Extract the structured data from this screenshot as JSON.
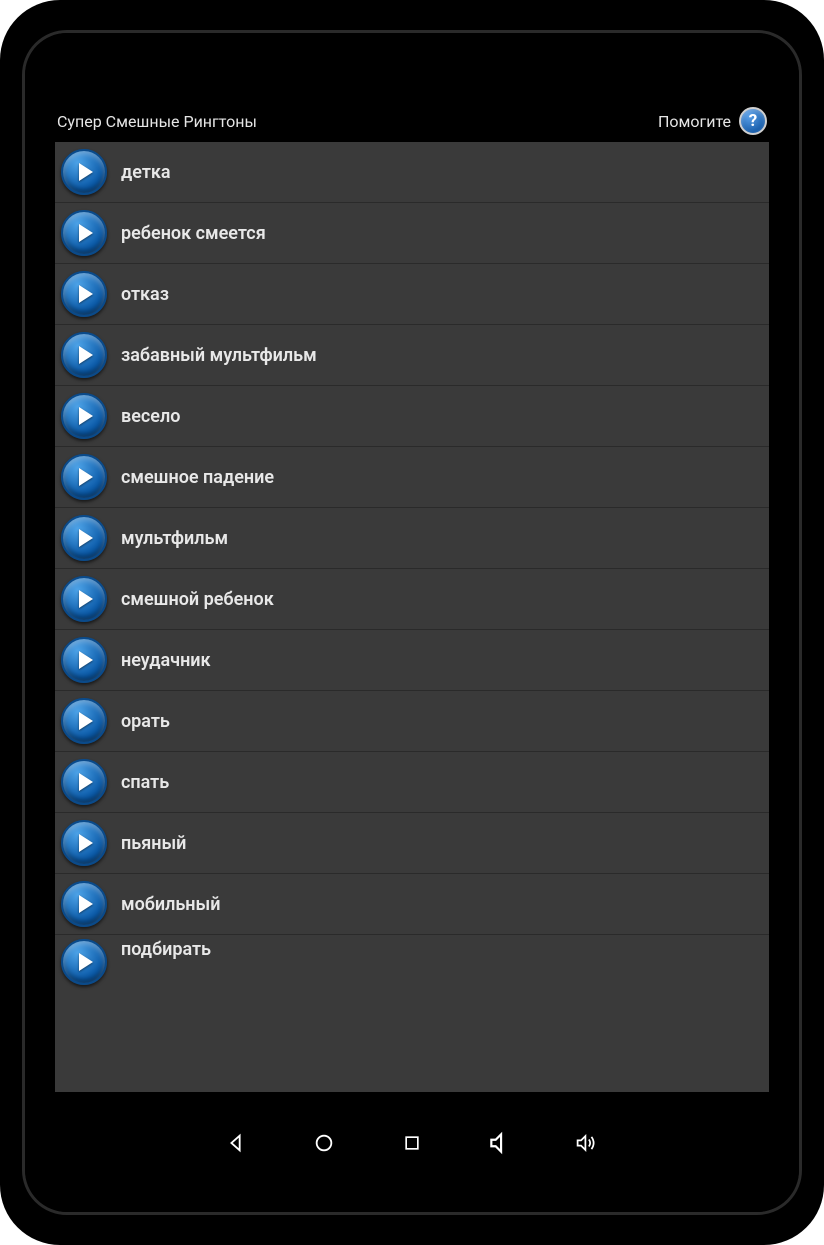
{
  "header": {
    "title": "Супер Смешные Рингтоны",
    "help_label": "Помогите",
    "help_glyph": "?"
  },
  "list": {
    "items": [
      {
        "label": "детка"
      },
      {
        "label": "ребенок смеется"
      },
      {
        "label": "отказ"
      },
      {
        "label": "забавный мультфильм"
      },
      {
        "label": "весело"
      },
      {
        "label": "смешное падение"
      },
      {
        "label": "мультфильм"
      },
      {
        "label": "смешной ребенок"
      },
      {
        "label": "неудачник"
      },
      {
        "label": "орать"
      },
      {
        "label": "спать"
      },
      {
        "label": "пьяный"
      },
      {
        "label": "мобильный"
      },
      {
        "label": "подбирать"
      }
    ]
  },
  "navbar": {
    "back": "back-icon",
    "home": "home-icon",
    "recent": "recent-icon",
    "volume_down": "volume-down-icon",
    "volume_up": "volume-up-icon"
  }
}
